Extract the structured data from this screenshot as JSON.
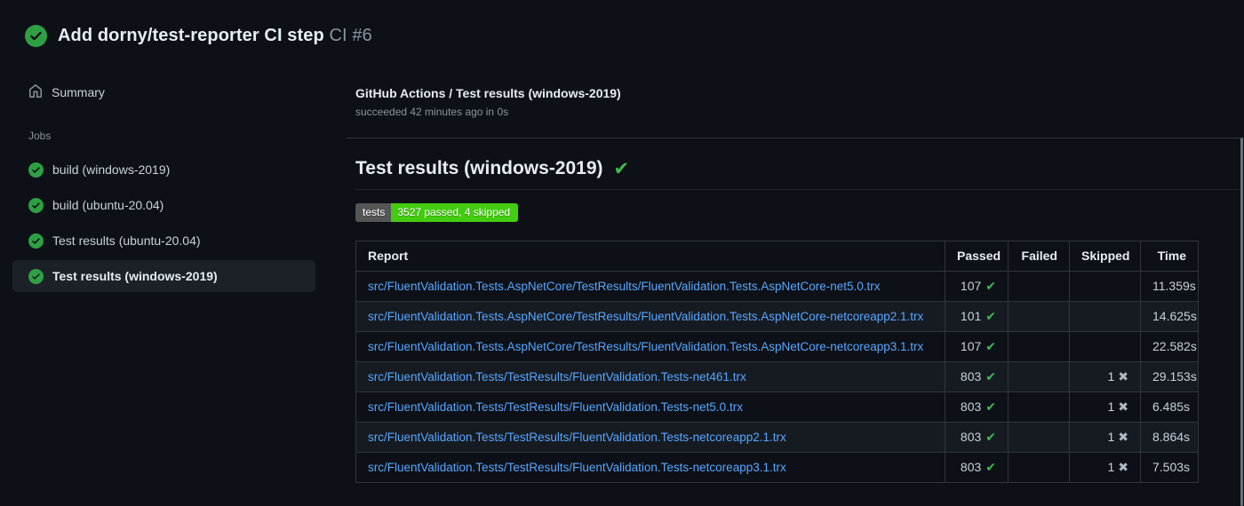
{
  "header": {
    "title": "Add dorny/test-reporter CI step",
    "run_label": "CI #6",
    "status_icon": "check-circle-fill"
  },
  "sidebar": {
    "summary_label": "Summary",
    "jobs_label": "Jobs",
    "jobs": [
      {
        "label": "build (windows-2019)",
        "selected": false
      },
      {
        "label": "build (ubuntu-20.04)",
        "selected": false
      },
      {
        "label": "Test results (ubuntu-20.04)",
        "selected": false
      },
      {
        "label": "Test results (windows-2019)",
        "selected": true
      }
    ]
  },
  "main": {
    "check_title": "GitHub Actions / Test results (windows-2019)",
    "check_status": "succeeded 42 minutes ago in 0s",
    "heading": "Test results (windows-2019)",
    "heading_check_icon": "check-icon",
    "badge": {
      "label": "tests",
      "value": "3527 passed, 4 skipped",
      "label_bg": "#555555",
      "value_bg": "#44cc11"
    },
    "table": {
      "columns": [
        "Report",
        "Passed",
        "Failed",
        "Skipped",
        "Time"
      ],
      "rows": [
        {
          "report": "src/FluentValidation.Tests.AspNetCore/TestResults/FluentValidation.Tests.AspNetCore-net5.0.trx",
          "passed": "107",
          "failed": "",
          "skipped": "",
          "time": "11.359s"
        },
        {
          "report": "src/FluentValidation.Tests.AspNetCore/TestResults/FluentValidation.Tests.AspNetCore-netcoreapp2.1.trx",
          "passed": "101",
          "failed": "",
          "skipped": "",
          "time": "14.625s"
        },
        {
          "report": "src/FluentValidation.Tests.AspNetCore/TestResults/FluentValidation.Tests.AspNetCore-netcoreapp3.1.trx",
          "passed": "107",
          "failed": "",
          "skipped": "",
          "time": "22.582s"
        },
        {
          "report": "src/FluentValidation.Tests/TestResults/FluentValidation.Tests-net461.trx",
          "passed": "803",
          "failed": "",
          "skipped": "1",
          "time": "29.153s"
        },
        {
          "report": "src/FluentValidation.Tests/TestResults/FluentValidation.Tests-net5.0.trx",
          "passed": "803",
          "failed": "",
          "skipped": "1",
          "time": "6.485s"
        },
        {
          "report": "src/FluentValidation.Tests/TestResults/FluentValidation.Tests-netcoreapp2.1.trx",
          "passed": "803",
          "failed": "",
          "skipped": "1",
          "time": "8.864s"
        },
        {
          "report": "src/FluentValidation.Tests/TestResults/FluentValidation.Tests-netcoreapp3.1.trx",
          "passed": "803",
          "failed": "",
          "skipped": "1",
          "time": "7.503s"
        }
      ]
    }
  },
  "colors": {
    "page_bg": "#0d1117",
    "success_green": "#2ea043",
    "check_green": "#3fb950",
    "link_blue": "#58a6ff",
    "border": "#30363d",
    "zebra_row": "#161b22",
    "muted_text": "#8b949e",
    "badge_label_bg": "#555555",
    "badge_value_bg": "#44cc11"
  },
  "glyphs": {
    "pass": "✔",
    "skip": "✖"
  }
}
